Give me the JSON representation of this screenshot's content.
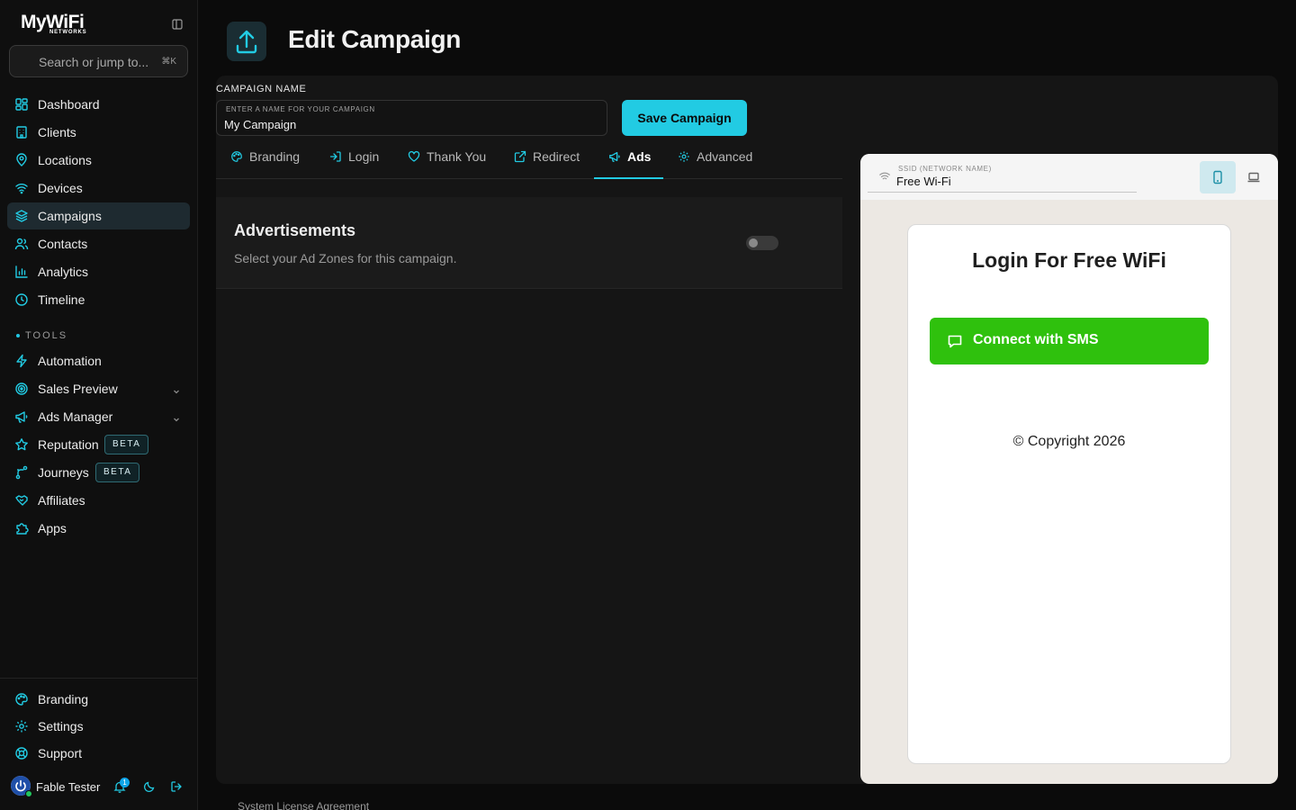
{
  "brand": {
    "name": "MyWiFi",
    "sub": "NETWORKS"
  },
  "search": {
    "placeholder": "Search or jump to...",
    "shortcut": "⌘K"
  },
  "nav": {
    "main": [
      {
        "label": "Dashboard",
        "icon": "dashboard-icon"
      },
      {
        "label": "Clients",
        "icon": "building-icon"
      },
      {
        "label": "Locations",
        "icon": "location-pin-icon"
      },
      {
        "label": "Devices",
        "icon": "wifi-icon"
      },
      {
        "label": "Campaigns",
        "icon": "layers-icon",
        "active": true
      },
      {
        "label": "Contacts",
        "icon": "users-icon"
      },
      {
        "label": "Analytics",
        "icon": "bar-chart-icon"
      },
      {
        "label": "Timeline",
        "icon": "clock-icon"
      }
    ],
    "tools_heading": "TOOLS",
    "tools": [
      {
        "label": "Automation",
        "icon": "bolt-icon"
      },
      {
        "label": "Sales Preview",
        "icon": "target-icon"
      },
      {
        "label": "Ads Manager",
        "icon": "megaphone-icon"
      },
      {
        "label": "Reputation",
        "icon": "star-icon",
        "badge": "BETA"
      },
      {
        "label": "Journeys",
        "icon": "route-icon",
        "badge": "BETA"
      },
      {
        "label": "Affiliates",
        "icon": "handshake-icon"
      },
      {
        "label": "Apps",
        "icon": "puzzle-icon"
      }
    ],
    "bottom": [
      {
        "label": "Branding",
        "icon": "palette-icon"
      },
      {
        "label": "Settings",
        "icon": "gear-icon"
      },
      {
        "label": "Support",
        "icon": "lifebuoy-icon"
      }
    ]
  },
  "user": {
    "name": "Fable Tester",
    "notifications": "1"
  },
  "page": {
    "title": "Edit Campaign"
  },
  "campaign": {
    "label": "CAMPAIGN NAME",
    "field_hint": "ENTER A NAME FOR YOUR CAMPAIGN",
    "value": "My Campaign",
    "save_label": "Save Campaign"
  },
  "tabs": [
    {
      "label": "Branding",
      "icon": "palette-icon"
    },
    {
      "label": "Login",
      "icon": "login-icon"
    },
    {
      "label": "Thank You",
      "icon": "heart-icon"
    },
    {
      "label": "Redirect",
      "icon": "external-link-icon"
    },
    {
      "label": "Ads",
      "icon": "megaphone-icon",
      "active": true
    },
    {
      "label": "Advanced",
      "icon": "gear-icon"
    }
  ],
  "ads": {
    "title": "Advertisements",
    "description": "Select your Ad Zones for this campaign.",
    "enabled": false
  },
  "preview": {
    "ssid_label": "SSID (NETWORK NAME)",
    "ssid_value": "Free Wi-Fi",
    "device": "mobile",
    "title": "Login For Free WiFi",
    "sms_button": "Connect with SMS",
    "copyright": "© Copyright 2026"
  },
  "colors": {
    "accent": "#22cbe3",
    "sms_green": "#2fc10d"
  },
  "footer": {
    "license": "System License Agreement"
  }
}
